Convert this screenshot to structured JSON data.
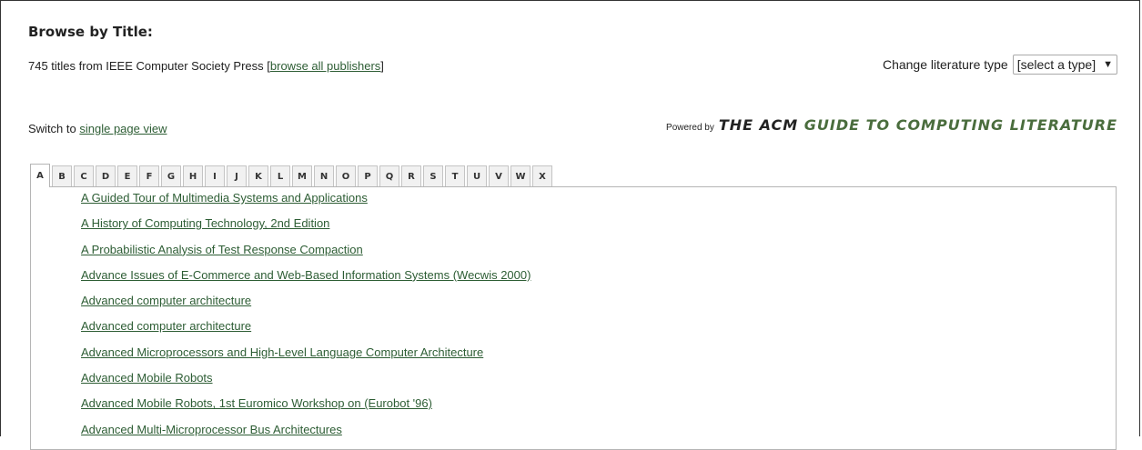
{
  "heading": "Browse by Title:",
  "summary": {
    "text": "745 titles from IEEE Computer Society Press [",
    "link": "browse all publishers",
    "suffix": "]"
  },
  "literature_type": {
    "label": "Change literature type",
    "selected": "[select a type]"
  },
  "switch": {
    "text": "Switch to ",
    "link": "single page view"
  },
  "powered_by": {
    "label": "Powered by",
    "acm": "THE ACM",
    "guide": "GUIDE TO COMPUTING LITERATURE"
  },
  "tabs": [
    "A",
    "B",
    "C",
    "D",
    "E",
    "F",
    "G",
    "H",
    "I",
    "J",
    "K",
    "L",
    "M",
    "N",
    "O",
    "P",
    "Q",
    "R",
    "S",
    "T",
    "U",
    "V",
    "W",
    "X"
  ],
  "active_tab": "A",
  "titles": [
    "A Guided Tour of Multimedia Systems and Applications",
    "A History of Computing Technology, 2nd Edition",
    "A Probabilistic Analysis of Test Response Compaction",
    "Advance Issues of E-Commerce and Web-Based Information Systems (Wecwis 2000)",
    "Advanced computer architecture",
    "Advanced computer architecture",
    "Advanced Microprocessors and High-Level Language Computer Architecture",
    "Advanced Mobile Robots",
    "Advanced Mobile Robots, 1st Euromico Workshop on (Eurobot '96)",
    "Advanced Multi-Microprocessor Bus Architectures"
  ]
}
